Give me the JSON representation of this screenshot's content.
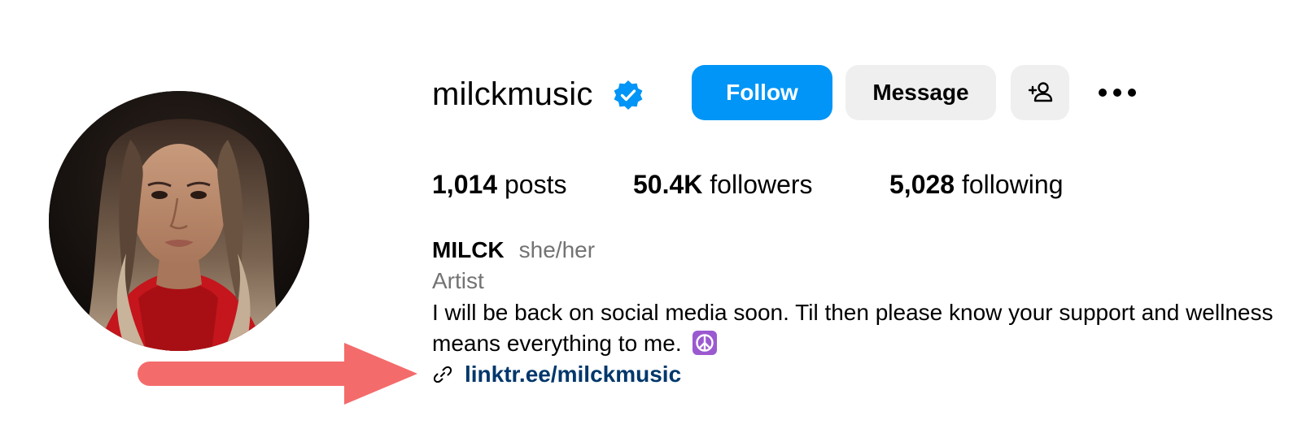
{
  "profile": {
    "username": "milckmusic",
    "verified": true,
    "buttons": {
      "follow": "Follow",
      "message": "Message"
    },
    "stats": {
      "posts_count": "1,014",
      "posts_label": "posts",
      "followers_count": "50.4K",
      "followers_label": "followers",
      "following_count": "5,028",
      "following_label": "following"
    },
    "bio": {
      "name": "MILCK",
      "pronouns": "she/her",
      "category": "Artist",
      "text": "I will be back on social media soon. Til then please know your support and wellness means everything to me.",
      "link": "linktr.ee/milckmusic"
    }
  },
  "icons": {
    "verified": "verified-badge-icon",
    "suggest": "person-add-icon",
    "more": "more-options-icon",
    "link": "link-icon",
    "peace": "peace-symbol-emoji",
    "annotation": "red-arrow"
  },
  "colors": {
    "follow_button": "#0095f6",
    "secondary_button": "#efefef",
    "link": "#00376b",
    "muted_text": "#737373",
    "verified_badge": "#0095f6",
    "peace_emoji": "#9b59d0",
    "annotation_arrow": "#f46b6b"
  }
}
